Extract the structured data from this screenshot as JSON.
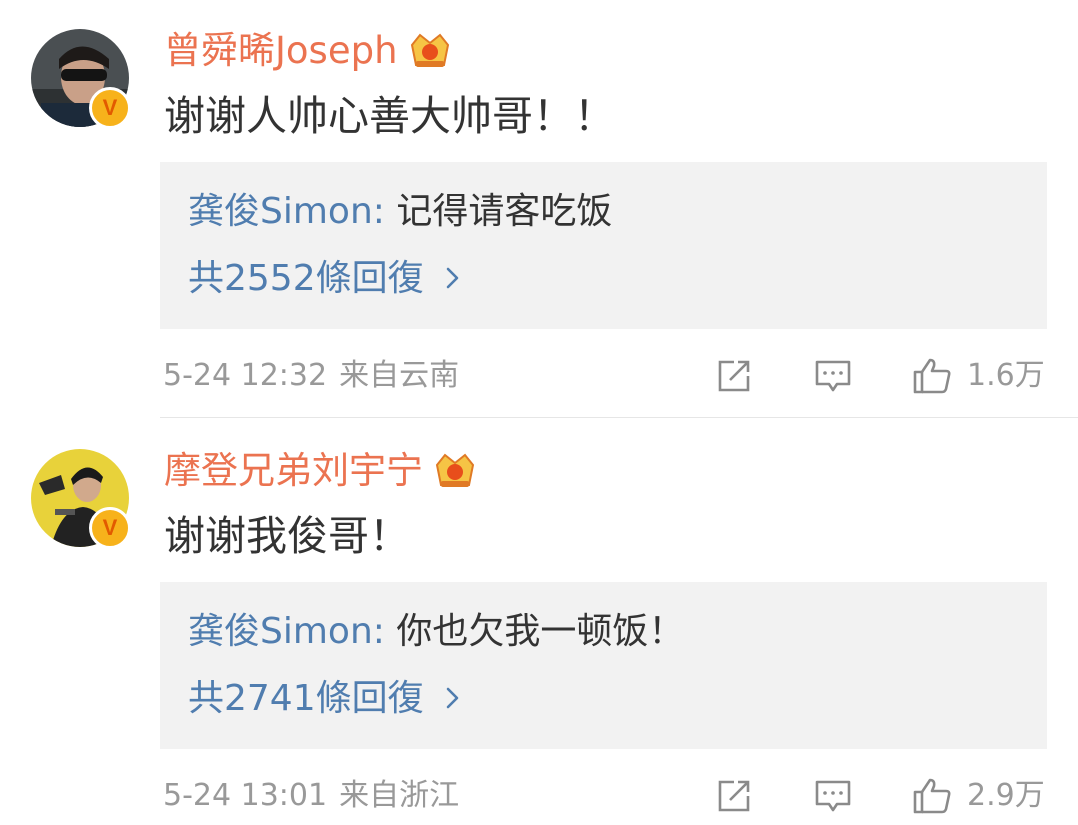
{
  "comments": [
    {
      "username": "曾舜晞Joseph",
      "text": "谢谢人帅心善大帅哥！！",
      "reply": {
        "user": "龚俊Simon",
        "sep": ": ",
        "text": "记得请客吃饭"
      },
      "reply_count": "共2552條回復",
      "time": "5-24 12:32",
      "source": "来自云南",
      "likes": "1.6万"
    },
    {
      "username": "摩登兄弟刘宇宁",
      "text": "谢谢我俊哥！",
      "reply": {
        "user": "龚俊Simon",
        "sep": ": ",
        "text": "你也欠我一顿饭！"
      },
      "reply_count": "共2741條回復",
      "time": "5-24 13:01",
      "source": "来自浙江",
      "likes": "2.9万"
    }
  ],
  "badge": {
    "letter": "V"
  },
  "colors": {
    "username": "#eb7350",
    "link": "#507daf",
    "text": "#333333",
    "meta": "#999999",
    "reply_bg": "#f2f2f2",
    "badge": "#f7b21b"
  },
  "icons": {
    "verified": "verified-v-icon",
    "vip": "crown-vip-icon",
    "share": "share-icon",
    "comment": "comment-icon",
    "like": "thumbs-up-icon",
    "more": "chevron-right-icon"
  }
}
